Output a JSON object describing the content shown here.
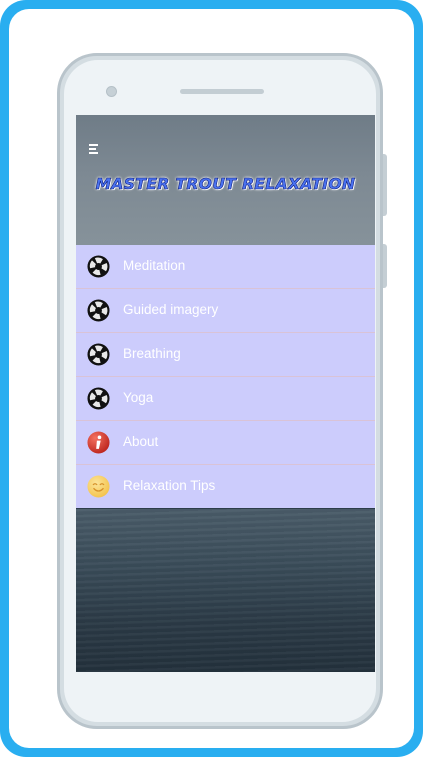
{
  "app": {
    "title": "MASTER TROUT RELAXATION"
  },
  "menu": {
    "items": [
      {
        "label": "Meditation",
        "icon": "aperture-icon"
      },
      {
        "label": "Guided imagery",
        "icon": "aperture-icon"
      },
      {
        "label": "Breathing",
        "icon": "aperture-icon"
      },
      {
        "label": "Yoga",
        "icon": "aperture-icon"
      },
      {
        "label": "About",
        "icon": "info-icon"
      },
      {
        "label": "Relaxation Tips",
        "icon": "smiley-icon"
      }
    ]
  },
  "colors": {
    "frame_border": "#29aef0",
    "menu_background": "#ccccfc",
    "menu_divider": "#d9c3d6",
    "title_fill": "#4a72f0",
    "info_red": "#d9322a",
    "smiley_yellow": "#f8cf62"
  }
}
